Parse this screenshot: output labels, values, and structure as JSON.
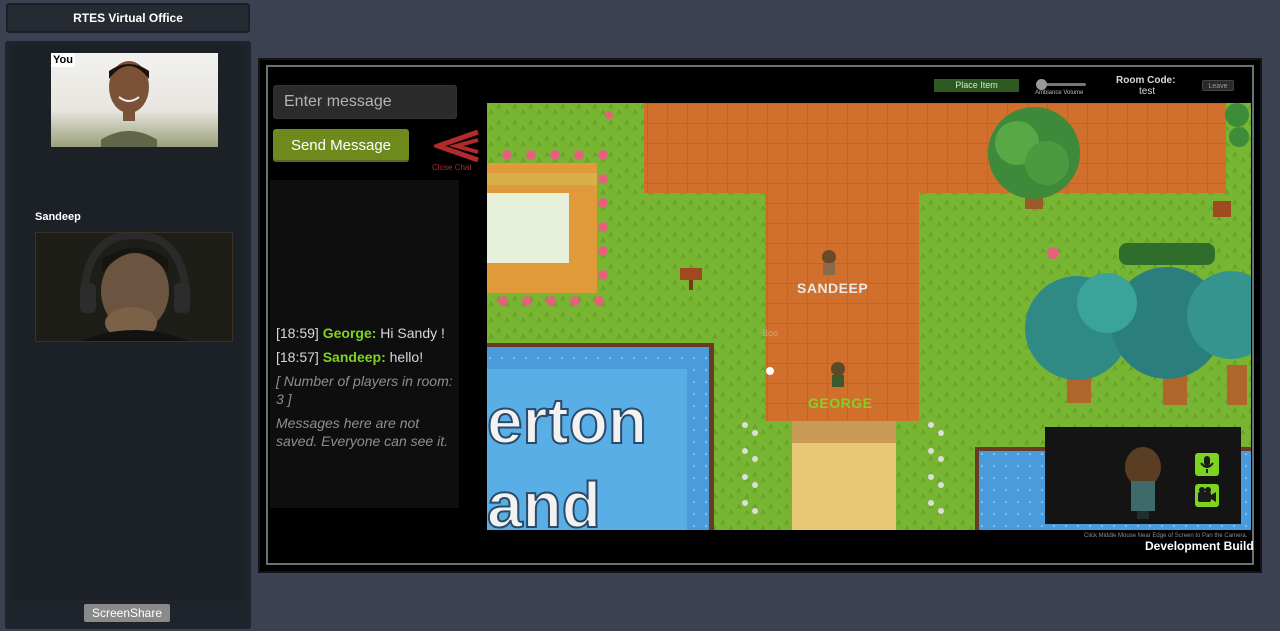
{
  "sidebar": {
    "title": "RTES Virtual Office",
    "you_label": "You",
    "peer_name": "Sandeep",
    "screenshare_label": "ScreenShare"
  },
  "chat": {
    "input_placeholder": "Enter message",
    "send_label": "Send Message",
    "close_label": "Close Chat",
    "messages": [
      {
        "time": "[18:59]",
        "name": "George:",
        "text": "Hi Sandy !"
      },
      {
        "time": "[18:57]",
        "name": "Sandeep:",
        "text": "hello!"
      }
    ],
    "system_notes": [
      "[ Number of players in room: 3 ]",
      "Messages here are not saved. Everyone can see it."
    ]
  },
  "game": {
    "place_item_label": "Place Item",
    "ambience_label": "Ambiance Volume",
    "room_code_label": "Room Code:",
    "room_code_value": "test",
    "leave_label": "Leave",
    "players": [
      {
        "name": "SANDEEP",
        "color": "#e8e8e8"
      },
      {
        "name": "GEORGE",
        "color": "#7ed321"
      }
    ],
    "npc_label": "Boo",
    "sign_text_line1": "erton",
    "sign_text_line2": "and",
    "hint_text": "Click Middle Mouse Near Edge of Screen to Pan the Camera.",
    "dev_build": "Development Build"
  },
  "colors": {
    "accent_green": "#7ed321",
    "send_button": "#6f8a1c",
    "close_red": "#a52a2a"
  },
  "icons": [
    "arrow-left-icon",
    "microphone-icon",
    "video-camera-icon"
  ]
}
